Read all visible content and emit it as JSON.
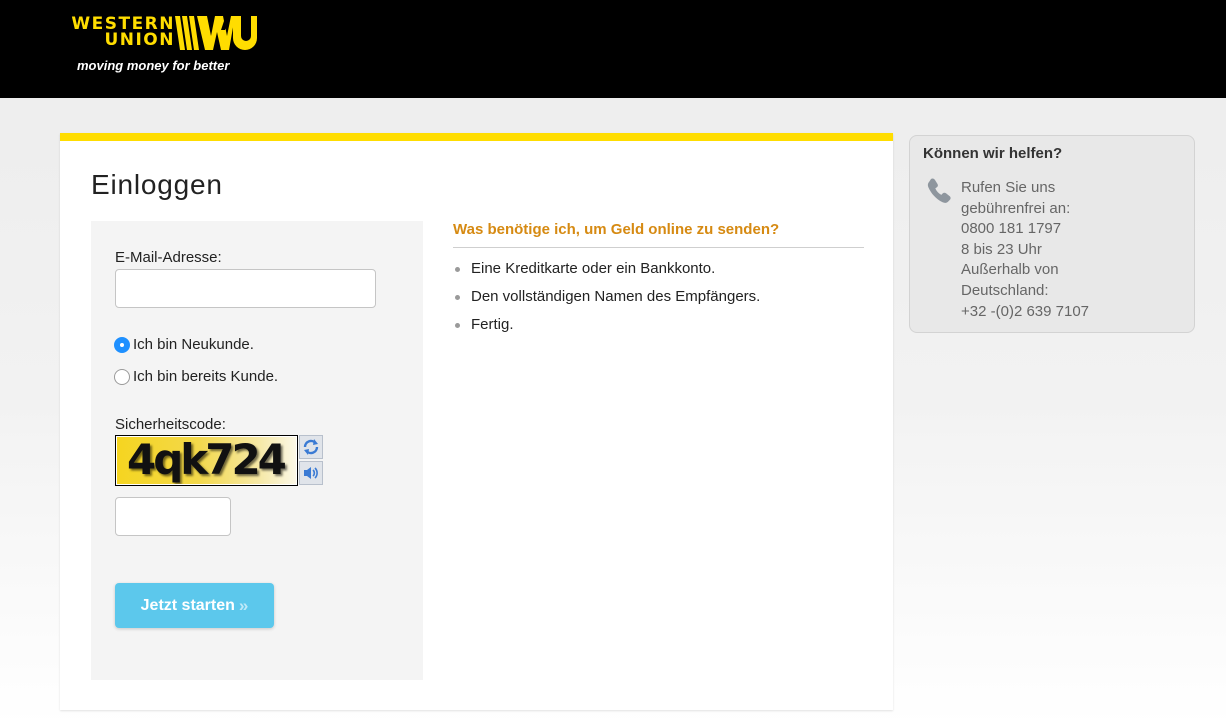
{
  "header": {
    "logo_line1": "WESTERN",
    "logo_line2": "UNION",
    "logo_tagline": "moving money for better",
    "brand_color": "#ffdd00"
  },
  "login": {
    "title": "Einloggen",
    "email_label": "E-Mail-Adresse:",
    "email_value": "",
    "radio_new": "Ich bin Neukunde.",
    "radio_existing": "Ich bin bereits Kunde.",
    "selected_option": "new",
    "security_label": "Sicherheitscode:",
    "captcha_text": "4qk724",
    "captcha_refresh_icon": "refresh-icon",
    "captcha_audio_icon": "speaker-icon",
    "security_value": "",
    "submit_label": "Jetzt starten",
    "submit_arrows": "»",
    "submit_color": "#5cc8ec"
  },
  "info": {
    "heading": "Was benötige ich, um Geld online zu senden?",
    "heading_color": "#d68a12",
    "items": [
      "Eine Kreditkarte oder ein Bankkonto.",
      "Den vollständigen Namen des Empfängers.",
      "Fertig."
    ]
  },
  "help": {
    "title": "Können wir helfen?",
    "icon": "phone-icon",
    "lines": [
      "Rufen Sie uns",
      "gebührenfrei an:",
      "0800 181 1797",
      "8 bis 23 Uhr",
      "Außerhalb von",
      "Deutschland:",
      "+32 -(0)2 639 7107"
    ]
  }
}
